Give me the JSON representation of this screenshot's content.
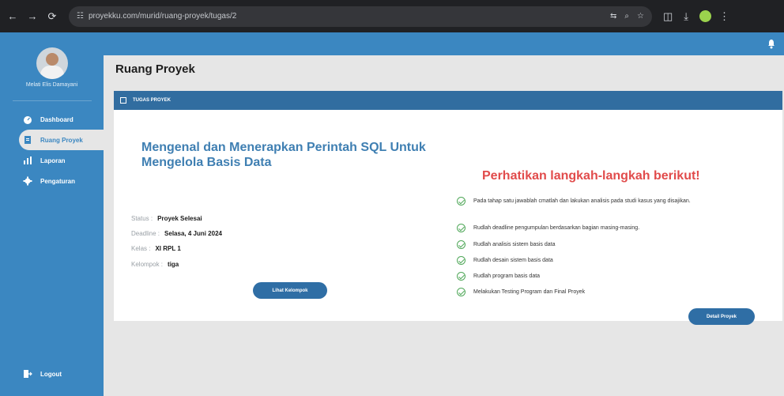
{
  "browser": {
    "url": "proyekku.com/murid/ruang-proyek/tugas/2",
    "icons": [
      "back-arrow-icon",
      "forward-arrow-icon",
      "reload-icon",
      "site-info-icon",
      "translate-icon",
      "zoom-icon",
      "star-icon",
      "extensions-icon",
      "download-icon",
      "profile-icon",
      "menu-dots-icon"
    ]
  },
  "sidebar": {
    "user_name": "Melati Elis Damayani",
    "menu": [
      {
        "label": "Dashboard",
        "icon": "dashboard-icon",
        "active": false
      },
      {
        "label": "Ruang Proyek",
        "icon": "folder-icon",
        "active": true
      },
      {
        "label": "Laporan",
        "icon": "chart-icon",
        "active": false
      },
      {
        "label": "Pengaturan",
        "icon": "gear-icon",
        "active": false
      }
    ],
    "logout": "Logout"
  },
  "page": {
    "title": "Ruang Proyek",
    "section": "TUGAS PROYEK"
  },
  "task": {
    "title": "Mengenal dan Menerapkan Perintah SQL Untuk Mengelola Basis Data",
    "status": {
      "label": "Status :",
      "value": "Proyek Selesai"
    },
    "deadline": {
      "label": "Deadline :",
      "value": "Selasa, 4 Juni 2024"
    },
    "kelas": {
      "label": "Kelas :",
      "value": "XI RPL 1"
    },
    "kelompok": {
      "label": "Kelompok :",
      "value": "tiga"
    },
    "group_button": "Lihat Kelompok",
    "detail_button": "Detail Proyek"
  },
  "steps": {
    "title": "Perhatikan langkah-langkah berikut!",
    "items": [
      "Pada tahap satu jawablah cmatlah dan lakukan analisis pada studi kasus yang disajikan.",
      "Rudlah deadline pengumpulan berdasarkan bagian masing-masing.",
      "Rudlah analisis sistem basis data",
      "Rudlah desain sistem basis data",
      "Rudlah program basis data",
      "Melakukan Testing Program dan Final Proyek"
    ]
  },
  "colors": {
    "sidebar": "#3b87c1",
    "header": "#316da0",
    "accent_red": "#e14b4b",
    "check_green": "#51a85a"
  }
}
